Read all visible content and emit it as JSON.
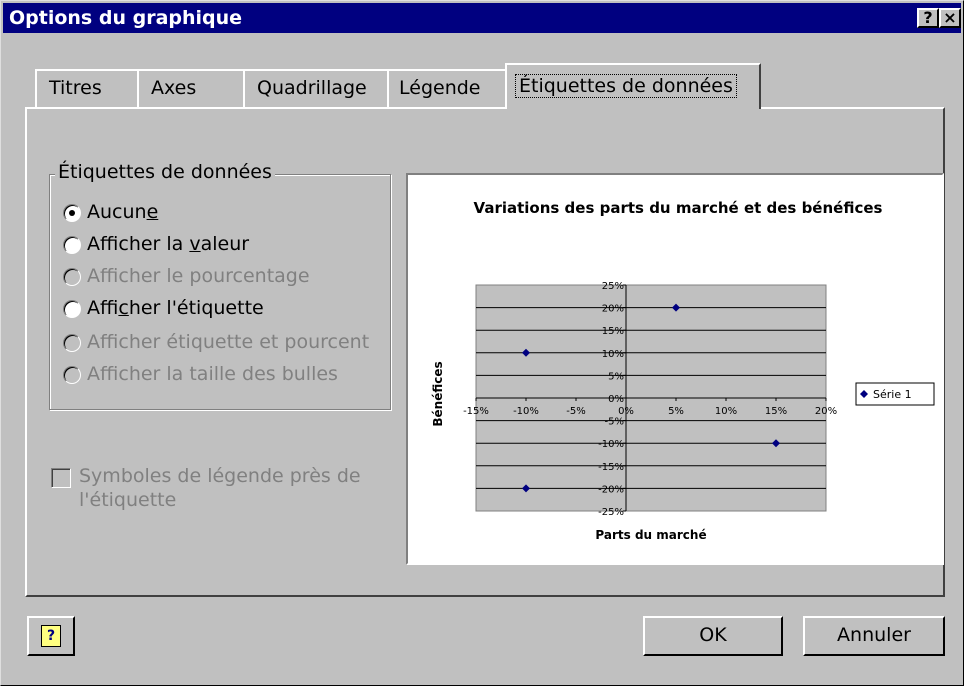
{
  "window": {
    "title": "Options du graphique",
    "help_btn": "?",
    "close_btn": "×"
  },
  "tabs": [
    {
      "label": "Titres"
    },
    {
      "label": "Axes"
    },
    {
      "label": "Quadrillage"
    },
    {
      "label": "Légende"
    },
    {
      "label": "Étiquettes de données",
      "active": true
    }
  ],
  "data_labels": {
    "group_title": "Étiquettes de données",
    "options": [
      {
        "label": "Aucune",
        "accel": "e",
        "selected": true,
        "enabled": true
      },
      {
        "label": "Afficher la valeur",
        "accel": "v",
        "selected": false,
        "enabled": true
      },
      {
        "label": "Afficher le pourcentage",
        "selected": false,
        "enabled": false
      },
      {
        "label": "Afficher l'étiquette",
        "accel": "c",
        "selected": false,
        "enabled": true
      },
      {
        "label": "Afficher étiquette et pourcent",
        "selected": false,
        "enabled": false
      },
      {
        "label": "Afficher la taille des bulles",
        "selected": false,
        "enabled": false
      }
    ],
    "legend_key_label": "Symboles de légende près de l'étiquette",
    "legend_key_checked": false,
    "legend_key_enabled": false
  },
  "chart_data": {
    "type": "scatter",
    "title": "Variations des parts du marché et des bénéfices",
    "xlabel": "Parts du marché",
    "ylabel": "Bénéfices",
    "xlim": [
      -15,
      20
    ],
    "ylim": [
      -25,
      25
    ],
    "x_ticks": [
      "-15%",
      "-10%",
      "-5%",
      "0%",
      "5%",
      "10%",
      "15%",
      "20%"
    ],
    "y_ticks": [
      "25%",
      "20%",
      "15%",
      "10%",
      "5%",
      "0%",
      "-5%",
      "-10%",
      "-15%",
      "-20%",
      "-25%"
    ],
    "grid": "horizontal",
    "legend": "right",
    "series": [
      {
        "name": "Série 1",
        "x": [
          5,
          -10,
          15,
          -10
        ],
        "y": [
          20,
          10,
          -10,
          -20
        ],
        "color": "#000080"
      }
    ]
  },
  "buttons": {
    "ok": "OK",
    "cancel": "Annuler"
  },
  "colors": {
    "titlebar": "#000080",
    "face": "#c0c0c0",
    "plot_area": "#c0c0c0",
    "marker": "#000080"
  }
}
